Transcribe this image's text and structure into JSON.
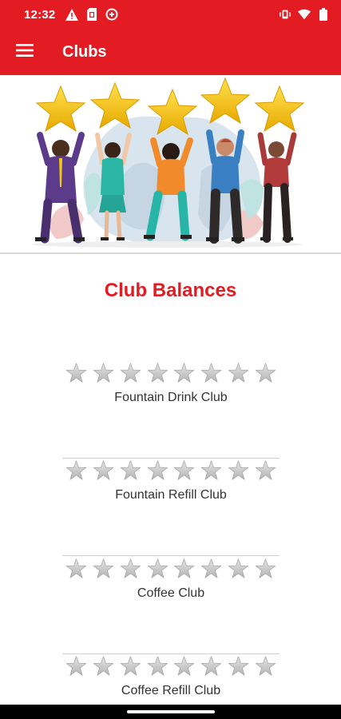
{
  "status_bar": {
    "time": "12:32",
    "left_icons": [
      "warning-icon",
      "sim-card-icon",
      "data-saver-icon"
    ],
    "right_icons": [
      "vibrate-icon",
      "wifi-icon",
      "battery-icon"
    ]
  },
  "app_bar": {
    "menu_icon": "hamburger-menu-icon",
    "title": "Clubs"
  },
  "hero": {
    "illustration": "people-holding-stars-illustration"
  },
  "section_title": "Club Balances",
  "clubs": [
    {
      "name": "Fountain Drink Club",
      "stars_total": 8,
      "stars_filled": 0
    },
    {
      "name": "Fountain Refill Club",
      "stars_total": 8,
      "stars_filled": 0
    },
    {
      "name": "Coffee Club",
      "stars_total": 8,
      "stars_filled": 0
    },
    {
      "name": "Coffee Refill Club",
      "stars_total": 8,
      "stars_filled": 0
    }
  ],
  "colors": {
    "brand_red": "#e31b23",
    "star_empty": "#c8c8c8",
    "star_gold": "#f5c518"
  }
}
